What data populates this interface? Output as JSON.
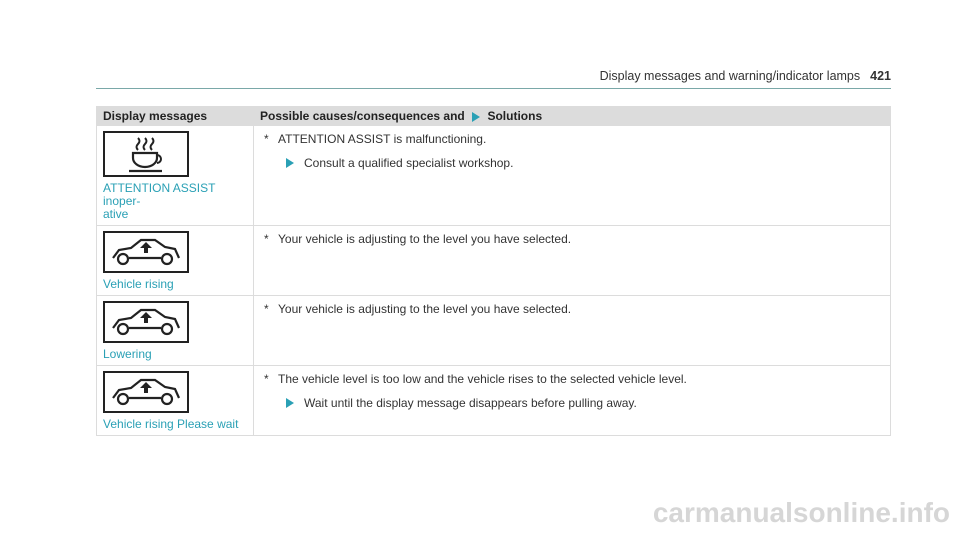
{
  "header": {
    "section_title": "Display messages and warning/indicator lamps",
    "page_number": "421"
  },
  "table": {
    "col_display": "Display messages",
    "col_causes": "Possible causes/consequences and",
    "col_solutions": "Solutions",
    "rows": [
      {
        "icon": "coffee-cup-icon",
        "label": "ATTENTION ASSIST inoper-\native",
        "cause_mark": "*",
        "cause": "ATTENTION ASSIST is malfunctioning.",
        "solution": "Consult a qualified specialist workshop."
      },
      {
        "icon": "vehicle-rising-icon",
        "label": "Vehicle rising",
        "cause_mark": "*",
        "cause": "Your vehicle is adjusting to the level you have selected."
      },
      {
        "icon": "vehicle-lowering-icon",
        "label": "Lowering",
        "cause_mark": "*",
        "cause": "Your vehicle is adjusting to the level you have selected."
      },
      {
        "icon": "vehicle-rising-wait-icon",
        "label": "Vehicle rising Please wait",
        "cause_mark": "*",
        "cause": "The vehicle level is too low and the vehicle rises to the selected vehicle level.",
        "solution": "Wait until the display message disappears before pulling away."
      }
    ]
  },
  "watermark": "carmanualsonline.info",
  "colors": {
    "accent": "#2aa0b5",
    "rule": "#7aa8a8",
    "table_header_bg": "#dcdcdc"
  }
}
